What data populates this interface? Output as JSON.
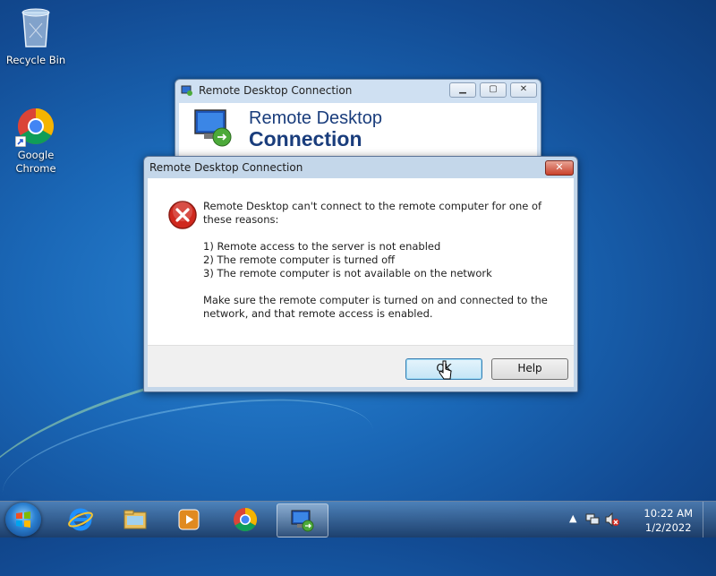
{
  "desktop": {
    "icons": [
      {
        "label": "Recycle Bin"
      },
      {
        "label": "Google Chrome"
      }
    ]
  },
  "background_window": {
    "title": "Remote Desktop Connection",
    "heading_line1": "Remote Desktop",
    "heading_line2": "Connection"
  },
  "dialog": {
    "title": "Remote Desktop Connection",
    "close_glyph": "✕",
    "message_lines": [
      "Remote Desktop can't connect to the remote computer for one of these reasons:",
      "",
      "1) Remote access to the server is not enabled",
      "2) The remote computer is turned off",
      "3) The remote computer is not available on the network",
      "",
      "Make sure the remote computer is turned on and connected to the network, and that remote access is enabled."
    ],
    "ok_label": "OK",
    "help_label": "Help"
  },
  "taskbar": {
    "items": [
      "start-orb",
      "internet-explorer-icon",
      "windows-explorer-icon",
      "media-player-icon",
      "chrome-icon",
      "remote-desktop-icon"
    ],
    "active_item": "remote-desktop-icon",
    "tray": {
      "show_hidden_glyph": "▲",
      "time": "10:22 AM",
      "date": "1/2/2022"
    }
  },
  "colors": {
    "desktop_blue": "#1a67b6",
    "dialog_frame": "#c4d7ea",
    "close_red": "#c9412b",
    "error_red": "#d0281e",
    "heading_blue": "#1a3d7c"
  }
}
